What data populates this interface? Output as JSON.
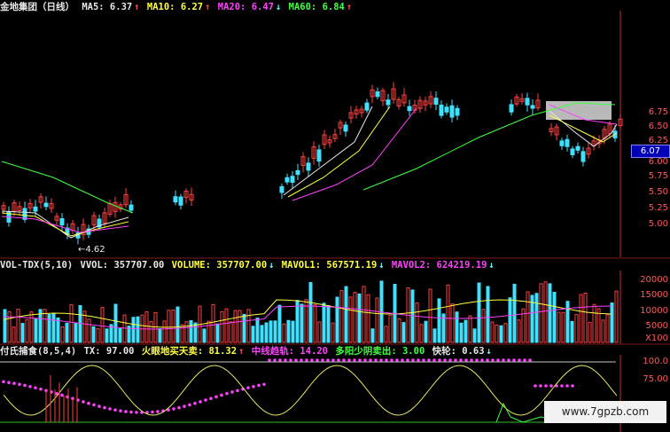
{
  "price_header": {
    "title": "金地集团（日线）",
    "ma5": "MA5: 6.37",
    "ma10": "MA10: 6.27",
    "ma20": "MA20: 6.47",
    "ma60": "MA60: 6.84",
    "up_arrow": "↑",
    "down_arrow": "↓"
  },
  "price_axis": [
    "6.75",
    "6.50",
    "6.25",
    "6.00",
    "5.75",
    "5.50",
    "5.25",
    "5.00"
  ],
  "current_price_tag": "6.07",
  "low_price_label": "4.62",
  "volume_header": {
    "name": "VOL-TDX(5,10)",
    "vvol": "VVOL: 357707.00",
    "volume": "VOLUME: 357707.00",
    "mavol1": "MAVOL1: 567571.19",
    "mavol2": "MAVOL2: 624219.19",
    "up_arrow": "↑",
    "down_arrow": "↓"
  },
  "volume_axis": [
    "20000",
    "15000",
    "10000",
    "5000",
    "X100"
  ],
  "indicator_header": {
    "name": "付氏捕食(8,5,4)",
    "tx": "TX: 97.00",
    "huoyan": "火眼地买天卖: 81.32",
    "zhongxian": "中线趋轨: 14.20",
    "duoyang": "多阳少阴卖出: 3.00",
    "kuailun": "快轮: 0.63",
    "up_arrow": "↑",
    "down_arrow": "↓"
  },
  "indicator_axis": [
    "100.0",
    "75.00"
  ],
  "watermark": "www.7gpzb.com",
  "colors": {
    "up_candle": "#ff4040",
    "down_candle": "#40e0ff",
    "ma5": "#e8e8e8",
    "ma10": "#ffff40",
    "ma20": "#ff40ff",
    "ma60": "#40ff40",
    "axis": "#ff5a5a"
  },
  "chart_data": {
    "type": "candlestick",
    "ylim": [
      4.5,
      6.9
    ],
    "volume_ylim": [
      0,
      22000
    ],
    "indicator_ylim": [
      0,
      110
    ]
  }
}
